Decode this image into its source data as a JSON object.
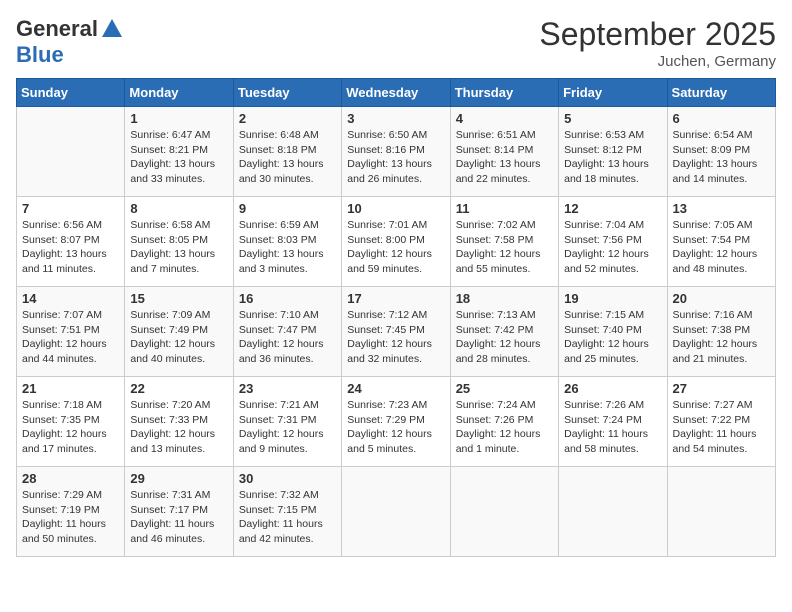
{
  "logo": {
    "general": "General",
    "blue": "Blue"
  },
  "title": "September 2025",
  "subtitle": "Juchen, Germany",
  "days": [
    "Sunday",
    "Monday",
    "Tuesday",
    "Wednesday",
    "Thursday",
    "Friday",
    "Saturday"
  ],
  "weeks": [
    [
      {
        "day": "",
        "content": ""
      },
      {
        "day": "1",
        "content": "Sunrise: 6:47 AM\nSunset: 8:21 PM\nDaylight: 13 hours\nand 33 minutes."
      },
      {
        "day": "2",
        "content": "Sunrise: 6:48 AM\nSunset: 8:18 PM\nDaylight: 13 hours\nand 30 minutes."
      },
      {
        "day": "3",
        "content": "Sunrise: 6:50 AM\nSunset: 8:16 PM\nDaylight: 13 hours\nand 26 minutes."
      },
      {
        "day": "4",
        "content": "Sunrise: 6:51 AM\nSunset: 8:14 PM\nDaylight: 13 hours\nand 22 minutes."
      },
      {
        "day": "5",
        "content": "Sunrise: 6:53 AM\nSunset: 8:12 PM\nDaylight: 13 hours\nand 18 minutes."
      },
      {
        "day": "6",
        "content": "Sunrise: 6:54 AM\nSunset: 8:09 PM\nDaylight: 13 hours\nand 14 minutes."
      }
    ],
    [
      {
        "day": "7",
        "content": "Sunrise: 6:56 AM\nSunset: 8:07 PM\nDaylight: 13 hours\nand 11 minutes."
      },
      {
        "day": "8",
        "content": "Sunrise: 6:58 AM\nSunset: 8:05 PM\nDaylight: 13 hours\nand 7 minutes."
      },
      {
        "day": "9",
        "content": "Sunrise: 6:59 AM\nSunset: 8:03 PM\nDaylight: 13 hours\nand 3 minutes."
      },
      {
        "day": "10",
        "content": "Sunrise: 7:01 AM\nSunset: 8:00 PM\nDaylight: 12 hours\nand 59 minutes."
      },
      {
        "day": "11",
        "content": "Sunrise: 7:02 AM\nSunset: 7:58 PM\nDaylight: 12 hours\nand 55 minutes."
      },
      {
        "day": "12",
        "content": "Sunrise: 7:04 AM\nSunset: 7:56 PM\nDaylight: 12 hours\nand 52 minutes."
      },
      {
        "day": "13",
        "content": "Sunrise: 7:05 AM\nSunset: 7:54 PM\nDaylight: 12 hours\nand 48 minutes."
      }
    ],
    [
      {
        "day": "14",
        "content": "Sunrise: 7:07 AM\nSunset: 7:51 PM\nDaylight: 12 hours\nand 44 minutes."
      },
      {
        "day": "15",
        "content": "Sunrise: 7:09 AM\nSunset: 7:49 PM\nDaylight: 12 hours\nand 40 minutes."
      },
      {
        "day": "16",
        "content": "Sunrise: 7:10 AM\nSunset: 7:47 PM\nDaylight: 12 hours\nand 36 minutes."
      },
      {
        "day": "17",
        "content": "Sunrise: 7:12 AM\nSunset: 7:45 PM\nDaylight: 12 hours\nand 32 minutes."
      },
      {
        "day": "18",
        "content": "Sunrise: 7:13 AM\nSunset: 7:42 PM\nDaylight: 12 hours\nand 28 minutes."
      },
      {
        "day": "19",
        "content": "Sunrise: 7:15 AM\nSunset: 7:40 PM\nDaylight: 12 hours\nand 25 minutes."
      },
      {
        "day": "20",
        "content": "Sunrise: 7:16 AM\nSunset: 7:38 PM\nDaylight: 12 hours\nand 21 minutes."
      }
    ],
    [
      {
        "day": "21",
        "content": "Sunrise: 7:18 AM\nSunset: 7:35 PM\nDaylight: 12 hours\nand 17 minutes."
      },
      {
        "day": "22",
        "content": "Sunrise: 7:20 AM\nSunset: 7:33 PM\nDaylight: 12 hours\nand 13 minutes."
      },
      {
        "day": "23",
        "content": "Sunrise: 7:21 AM\nSunset: 7:31 PM\nDaylight: 12 hours\nand 9 minutes."
      },
      {
        "day": "24",
        "content": "Sunrise: 7:23 AM\nSunset: 7:29 PM\nDaylight: 12 hours\nand 5 minutes."
      },
      {
        "day": "25",
        "content": "Sunrise: 7:24 AM\nSunset: 7:26 PM\nDaylight: 12 hours\nand 1 minute."
      },
      {
        "day": "26",
        "content": "Sunrise: 7:26 AM\nSunset: 7:24 PM\nDaylight: 11 hours\nand 58 minutes."
      },
      {
        "day": "27",
        "content": "Sunrise: 7:27 AM\nSunset: 7:22 PM\nDaylight: 11 hours\nand 54 minutes."
      }
    ],
    [
      {
        "day": "28",
        "content": "Sunrise: 7:29 AM\nSunset: 7:19 PM\nDaylight: 11 hours\nand 50 minutes."
      },
      {
        "day": "29",
        "content": "Sunrise: 7:31 AM\nSunset: 7:17 PM\nDaylight: 11 hours\nand 46 minutes."
      },
      {
        "day": "30",
        "content": "Sunrise: 7:32 AM\nSunset: 7:15 PM\nDaylight: 11 hours\nand 42 minutes."
      },
      {
        "day": "",
        "content": ""
      },
      {
        "day": "",
        "content": ""
      },
      {
        "day": "",
        "content": ""
      },
      {
        "day": "",
        "content": ""
      }
    ]
  ]
}
